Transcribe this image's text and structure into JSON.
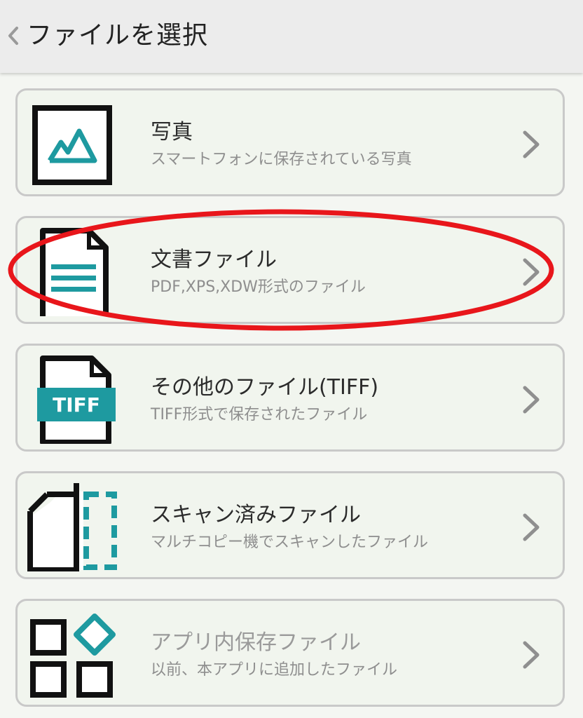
{
  "header": {
    "back_icon": "chevron-left-icon",
    "title": "ファイルを選択"
  },
  "colors": {
    "accent": "#1e9aa0",
    "highlight": "#e8161b",
    "card_background": "#f1f5ee",
    "card_border": "#c9c9c9"
  },
  "items": [
    {
      "title": "写真",
      "subtitle": "スマートフォンに保存されている写真",
      "icon": "photo-icon",
      "enabled": true
    },
    {
      "title": "文書ファイル",
      "subtitle": "PDF,XPS,XDW形式のファイル",
      "icon": "document-icon",
      "enabled": true,
      "highlighted": true
    },
    {
      "title": "その他のファイル(TIFF)",
      "subtitle": "TIFF形式で保存されたファイル",
      "icon": "tiff-file-icon",
      "icon_label": "TIFF",
      "enabled": true
    },
    {
      "title": "スキャン済みファイル",
      "subtitle": "マルチコピー機でスキャンしたファイル",
      "icon": "scanned-file-icon",
      "enabled": true
    },
    {
      "title": "アプリ内保存ファイル",
      "subtitle": "以前、本アプリに追加したファイル",
      "icon": "app-storage-icon",
      "enabled": false
    }
  ]
}
